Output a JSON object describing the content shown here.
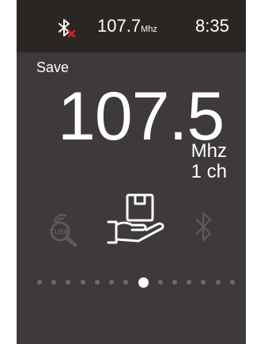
{
  "status_bar": {
    "bluetooth_status_icon": "bluetooth-disabled-icon",
    "frequency": "107.7",
    "frequency_unit": "Mhz",
    "time": "8:35"
  },
  "main": {
    "save_label": "Save",
    "frequency": "107.5",
    "unit": "Mhz",
    "channel": "1 ch"
  },
  "carousel": {
    "items": [
      {
        "icon": "tune-search-icon",
        "selected": false
      },
      {
        "icon": "save-hand-box-icon",
        "selected": true
      },
      {
        "icon": "bluetooth-icon",
        "selected": false
      }
    ]
  },
  "pager": {
    "total": 14,
    "active_index": 7
  },
  "colors": {
    "screen_background": "#3d3a39",
    "status_bar_background": "#2b2624",
    "text": "#ffffff",
    "inactive_icon": "#5e5a58",
    "bluetooth_off_accent": "#e02020"
  }
}
